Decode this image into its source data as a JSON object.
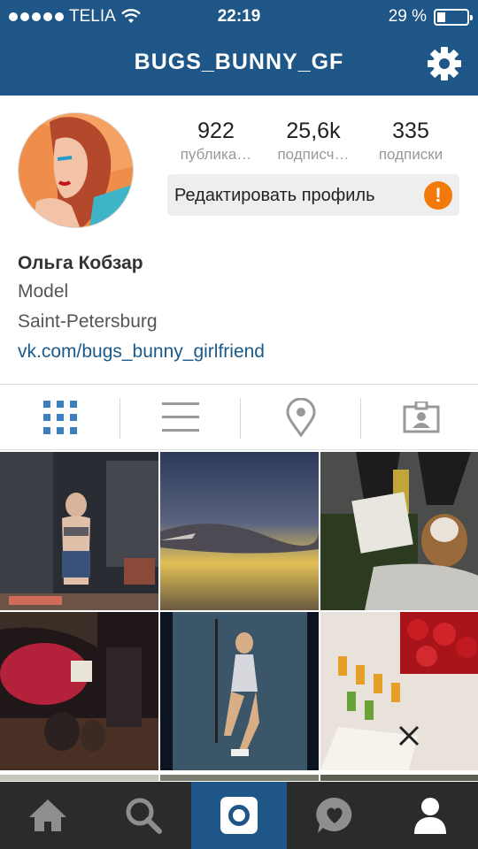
{
  "status_bar": {
    "carrier": "TELIA",
    "time": "22:19",
    "battery": "29 %",
    "battery_level": 0.29
  },
  "header": {
    "username": "BUGS_BUNNY_GF",
    "settings_icon": "gear-icon"
  },
  "stats": [
    {
      "value": "922",
      "label": "публика…"
    },
    {
      "value": "25,6k",
      "label": "подписч…"
    },
    {
      "value": "335",
      "label": "подписки"
    }
  ],
  "edit_profile": {
    "label": "Редактировать профиль",
    "warning": "!"
  },
  "bio": {
    "name": "Ольга Кобзар",
    "occupation": "Model",
    "city": "Saint-Petersburg",
    "link": "vk.com/bugs_bunny_girlfriend"
  },
  "view_tabs": [
    {
      "icon": "grid-icon",
      "active": true
    },
    {
      "icon": "list-icon",
      "active": false
    },
    {
      "icon": "location-pin-icon",
      "active": false
    },
    {
      "icon": "tagged-photos-icon",
      "active": false
    }
  ],
  "bottom_nav": [
    {
      "icon": "home-icon",
      "active": false
    },
    {
      "icon": "search-icon",
      "active": false
    },
    {
      "icon": "camera-icon",
      "active": true
    },
    {
      "icon": "activity-heart-icon",
      "active": false
    },
    {
      "icon": "profile-icon",
      "active": false
    }
  ],
  "colors": {
    "brand_blue": "#1e5687",
    "link_blue": "#1a5a8a",
    "active_tab_blue": "#3d7ebf",
    "warning_orange": "#f27a0a",
    "bottom_bar": "#2b2b2b"
  }
}
